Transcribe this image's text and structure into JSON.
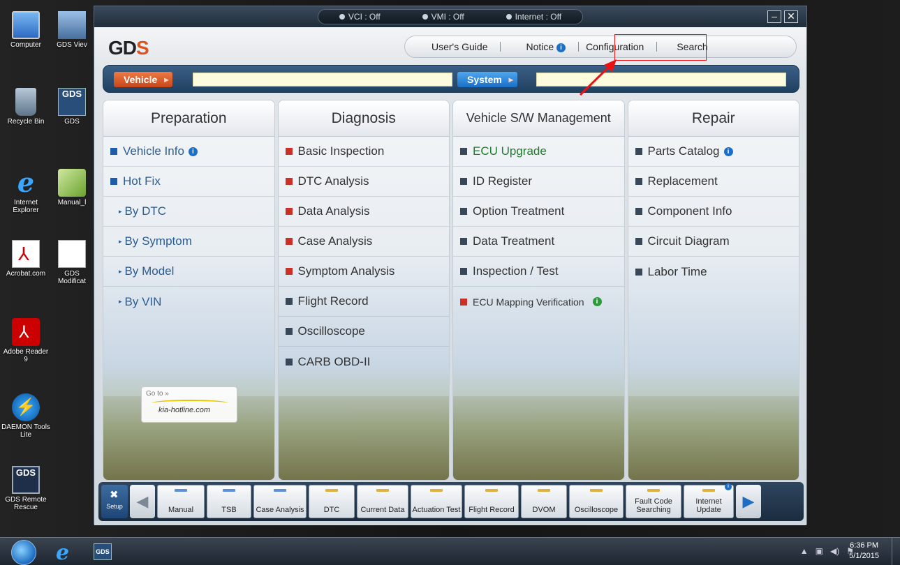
{
  "desktop": {
    "icons_col1": [
      {
        "label": "Computer",
        "icon": "computer-icon"
      },
      {
        "label": "Recycle Bin",
        "icon": "recycle-bin-icon"
      },
      {
        "label": "Internet Explorer",
        "icon": "ie-icon"
      },
      {
        "label": "Acrobat.com",
        "icon": "acrobat-icon"
      },
      {
        "label": "Adobe Reader 9",
        "icon": "adobe-reader-icon"
      },
      {
        "label": "DAEMON Tools Lite",
        "icon": "daemon-tools-icon"
      },
      {
        "label": "GDS Remote Rescue",
        "icon": "gds-remote-icon"
      }
    ],
    "icons_col2": [
      {
        "label": "GDS Viev",
        "icon": "gds-viewer-icon"
      },
      {
        "label": "GDS",
        "icon": "gds-icon",
        "glyph": "GDS"
      },
      {
        "label": "Manual_l",
        "icon": "manual-icon"
      },
      {
        "label": "GDS Modificat",
        "icon": "document-icon"
      }
    ]
  },
  "window": {
    "status": {
      "vci": "VCI : Off",
      "vmi": "VMI : Off",
      "internet": "Internet : Off"
    },
    "controls": {
      "minimize": "–",
      "close": "✕"
    },
    "logo": {
      "text": "GD",
      "accent": "S"
    },
    "topnav": {
      "users_guide": "User's Guide",
      "notice": "Notice",
      "configuration": "Configuration",
      "search": "Search"
    },
    "selector": {
      "vehicle_label": "Vehicle",
      "system_label": "System",
      "vehicle_value": "",
      "system_value": ""
    },
    "columns": {
      "preparation": {
        "title": "Preparation",
        "items": {
          "vehicle_info": "Vehicle Info",
          "hot_fix": "Hot Fix",
          "by_dtc": "By DTC",
          "by_symptom": "By Symptom",
          "by_model": "By Model",
          "by_vin": "By VIN"
        },
        "kia_link": {
          "goto": "Go to »",
          "site": "kia-hotline.com"
        }
      },
      "diagnosis": {
        "title": "Diagnosis",
        "items": [
          "Basic Inspection",
          "DTC Analysis",
          "Data Analysis",
          "Case Analysis",
          "Symptom Analysis",
          "Flight Record",
          "Oscilloscope",
          "CARB OBD-II"
        ]
      },
      "swm": {
        "title": "Vehicle S/W Management",
        "items": [
          "ECU Upgrade",
          "ID Register",
          "Option Treatment",
          "Data Treatment",
          "Inspection / Test",
          "ECU Mapping Verification"
        ]
      },
      "repair": {
        "title": "Repair",
        "items": [
          "Parts Catalog",
          "Replacement",
          "Component Info",
          "Circuit Diagram",
          "Labor Time"
        ]
      }
    },
    "toolbar": {
      "setup": "Setup",
      "buttons": [
        {
          "label": "Manual",
          "led": "blue"
        },
        {
          "label": "TSB",
          "led": "blue"
        },
        {
          "label": "Case Analysis",
          "led": "blue"
        },
        {
          "label": "DTC",
          "led": "yellow"
        },
        {
          "label": "Current Data",
          "led": "yellow"
        },
        {
          "label": "Actuation Test",
          "led": "yellow"
        },
        {
          "label": "Flight Record",
          "led": "yellow"
        },
        {
          "label": "DVOM",
          "led": "yellow"
        },
        {
          "label": "Oscilloscope",
          "led": "yellow"
        },
        {
          "label": "Fault Code Searching",
          "led": "yellow"
        },
        {
          "label": "Internet Update",
          "led": "yellow"
        }
      ]
    }
  },
  "taskbar": {
    "gds_label": "GDS",
    "time": "6:36 PM",
    "date": "5/1/2015"
  },
  "colors": {
    "accent_orange": "#c7471a",
    "accent_blue": "#1b6fc6",
    "green_text": "#1c7e2c",
    "highlight_red": "#ee1111"
  }
}
